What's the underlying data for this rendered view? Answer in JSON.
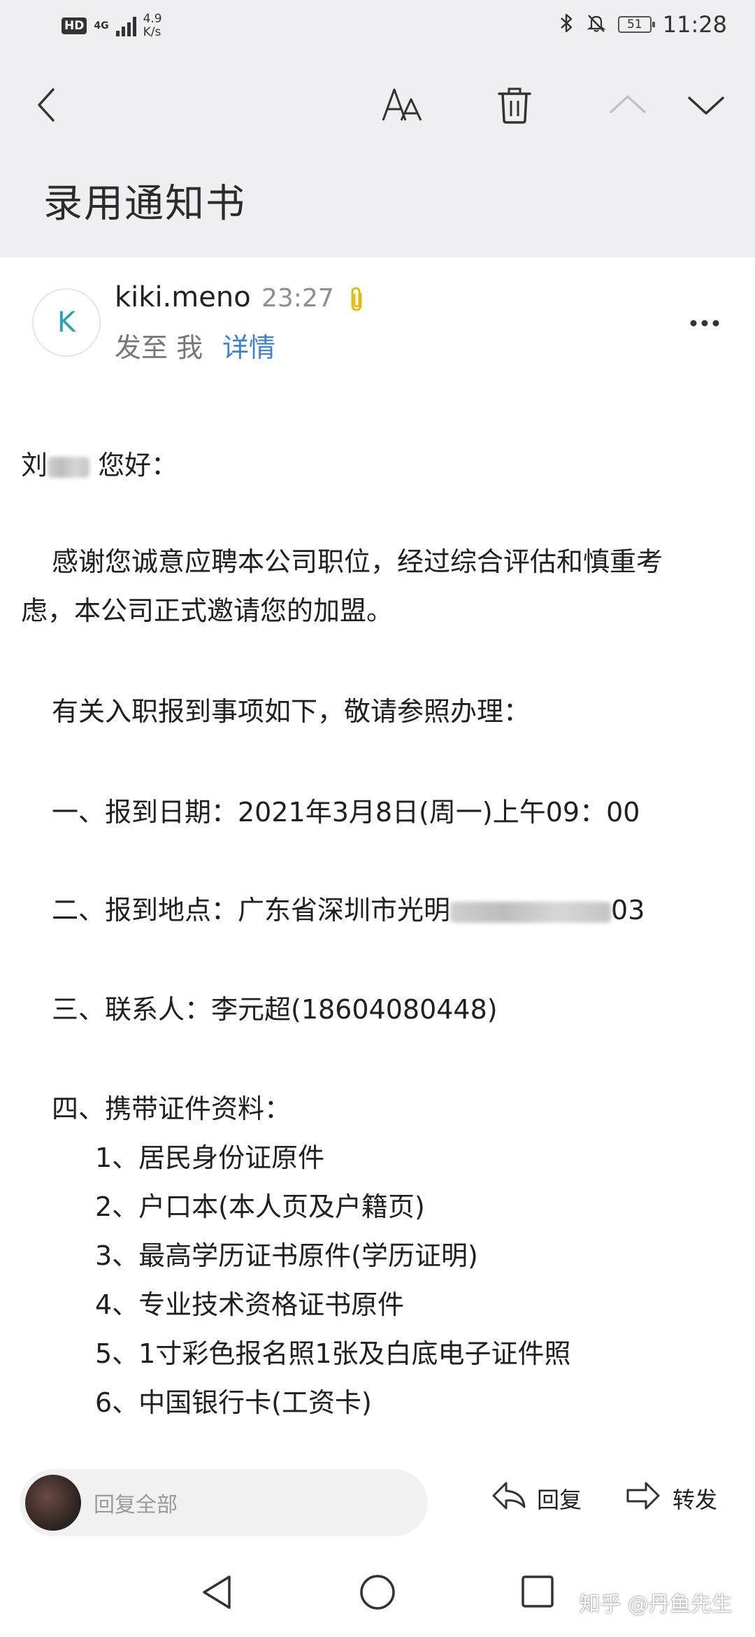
{
  "status_bar": {
    "hd": "HD",
    "network": "4G",
    "speed_value": "4.9",
    "speed_unit": "K/s",
    "battery": "51",
    "time": "11:28"
  },
  "toolbar": {
    "icons": [
      "back-icon",
      "font-size-icon",
      "trash-icon",
      "chevron-up-icon",
      "chevron-down-icon"
    ]
  },
  "mail": {
    "subject": "录用通知书",
    "sender": {
      "initial": "K",
      "name": "kiki.meno",
      "time": "23:27",
      "sent_to": "发至 我",
      "details_link": "详情"
    },
    "body": {
      "greeting_name": "刘",
      "greeting_suffix": "您好：",
      "paragraph1_line1": "感谢您诚意应聘本公司职位，经过综合评估和慎重考",
      "paragraph1_line2": "虑，本公司正式邀请您的加盟。",
      "paragraph2": "有关入职报到事项如下，敬请参照办理：",
      "item1": "一、报到日期：2021年3月8日(周一)上午09：00",
      "item2_prefix": "二、报到地点：广东省深圳市光明",
      "item2_suffix": "03",
      "item3": "三、联系人：李元超(18604080448)",
      "item4_title": "四、携带证件资料：",
      "documents": [
        "1、居民身份证原件",
        "2、户口本(本人页及户籍页)",
        "3、最高学历证书原件(学历证明)",
        "4、专业技术资格证书原件",
        "5、1寸彩色报名照1张及白底电子证件照",
        "6、中国银行卡(工资卡)"
      ]
    }
  },
  "reply_bar": {
    "reply_all_placeholder": "回复全部",
    "reply_label": "回复",
    "forward_label": "转发"
  },
  "nav_bar": {
    "watermark": "知乎 @丹鱼先生"
  },
  "colors": {
    "header_bg": "#efeff1",
    "link": "#3b82d4",
    "avatar_letter": "#27a3b6",
    "attachment": "#e6b800"
  }
}
